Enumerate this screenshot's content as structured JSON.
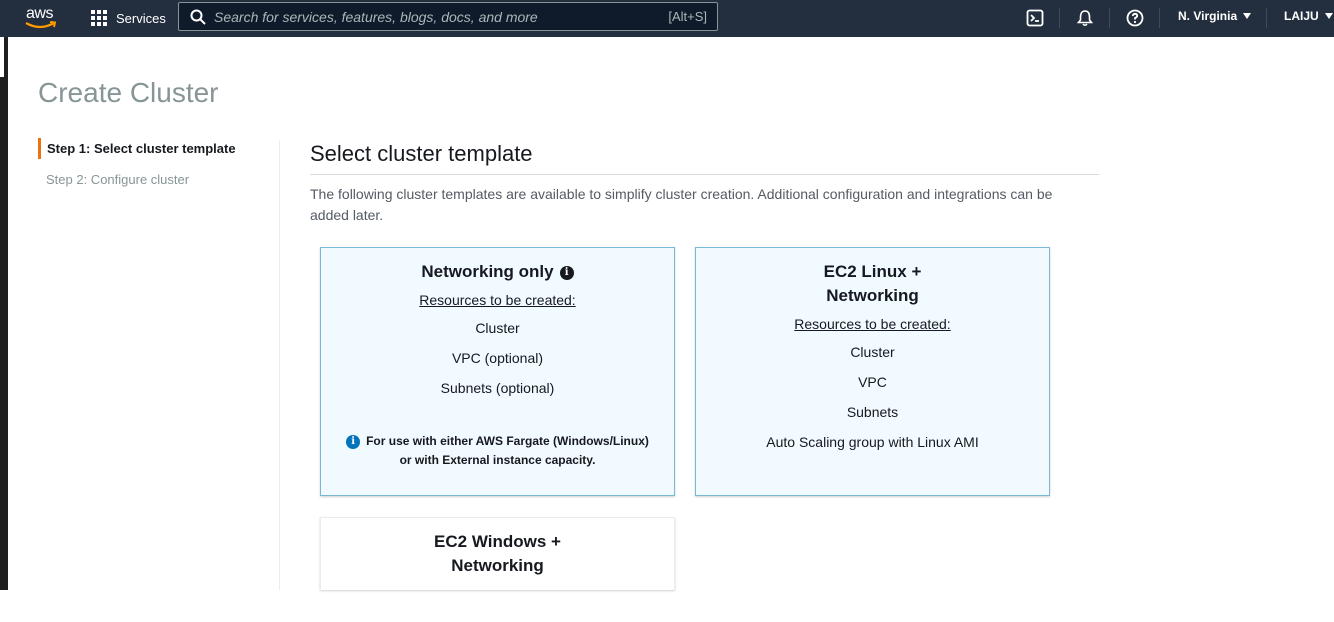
{
  "topnav": {
    "logo_text": "aws",
    "services_label": "Services",
    "search_placeholder": "Search for services, features, blogs, docs, and more",
    "search_shortcut": "[Alt+S]",
    "region_label": "N. Virginia",
    "user_label": "LAIJU"
  },
  "page": {
    "title": "Create Cluster"
  },
  "steps": [
    {
      "label": "Step 1: Select cluster template",
      "active": true
    },
    {
      "label": "Step 2: Configure cluster",
      "active": false
    }
  ],
  "main": {
    "section_title": "Select cluster template",
    "description": "The following cluster templates are available to simplify cluster creation. Additional configuration and integrations can be added later."
  },
  "cards": [
    {
      "title": "Networking only",
      "resources_label": "Resources to be created:",
      "resources": [
        "Cluster",
        "VPC (optional)",
        "Subnets (optional)"
      ],
      "note_line1": "For use with either AWS Fargate (Windows/Linux)",
      "note_line2": "or with External instance capacity."
    },
    {
      "title_line1": "EC2 Linux +",
      "title_line2": "Networking",
      "resources_label": "Resources to be created:",
      "resources": [
        "Cluster",
        "VPC",
        "Subnets",
        "Auto Scaling group with Linux AMI"
      ]
    },
    {
      "title_line1": "EC2 Windows +",
      "title_line2": "Networking"
    }
  ],
  "colors": {
    "nav_bg": "#232f3e",
    "accent": "#ec7211",
    "selected_card_bg": "#f1faff",
    "selected_card_border": "#79b9d8",
    "info_blue": "#0073bb"
  },
  "icons": [
    "aws-logo",
    "services-grid-icon",
    "search-icon",
    "cloudshell-icon",
    "bell-icon",
    "help-icon",
    "info-icon"
  ]
}
